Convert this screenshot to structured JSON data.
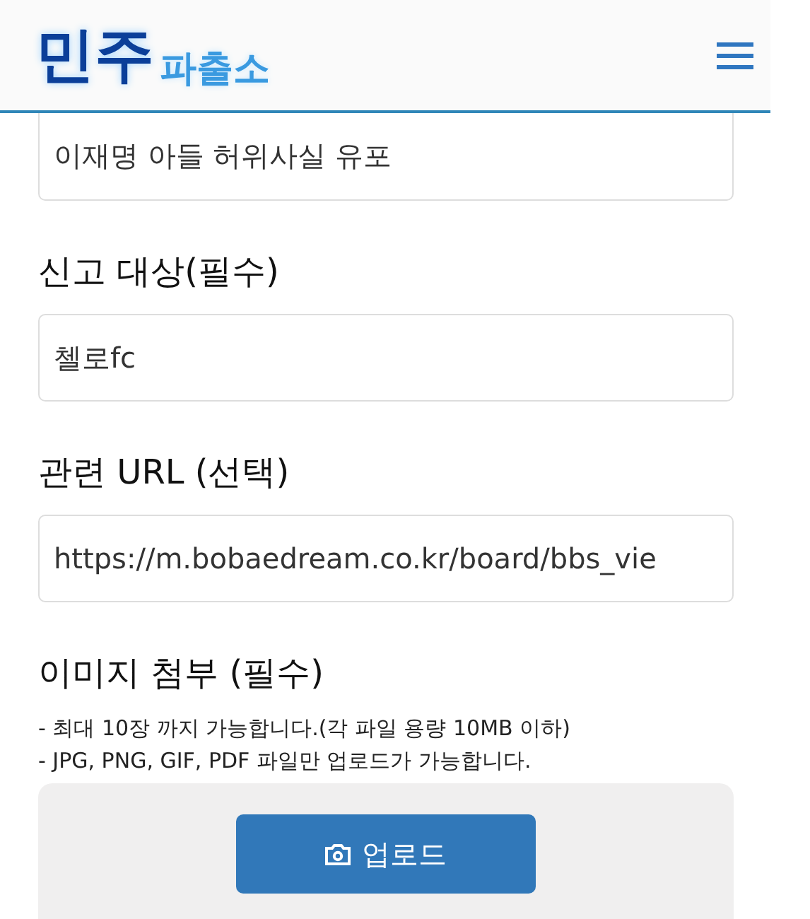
{
  "header": {
    "logo_main": "민주",
    "logo_sub": "파출소"
  },
  "fields": [
    {
      "value": "이재명 아들 허위사실 유포"
    },
    {
      "label": "신고 대상(필수)",
      "value": "첼로fc"
    },
    {
      "label": "관련 URL (선택)",
      "value": "https://m.bobaedream.co.kr/board/bbs_vie"
    }
  ],
  "attachment": {
    "label": "이미지 첨부 (필수)",
    "notes": [
      "- 최대 10장 까지 가능합니다.(각 파일 용량 10MB 이하)",
      "- JPG, PNG, GIF, PDF 파일만 업로드가 가능합니다."
    ],
    "button": "업로드"
  }
}
